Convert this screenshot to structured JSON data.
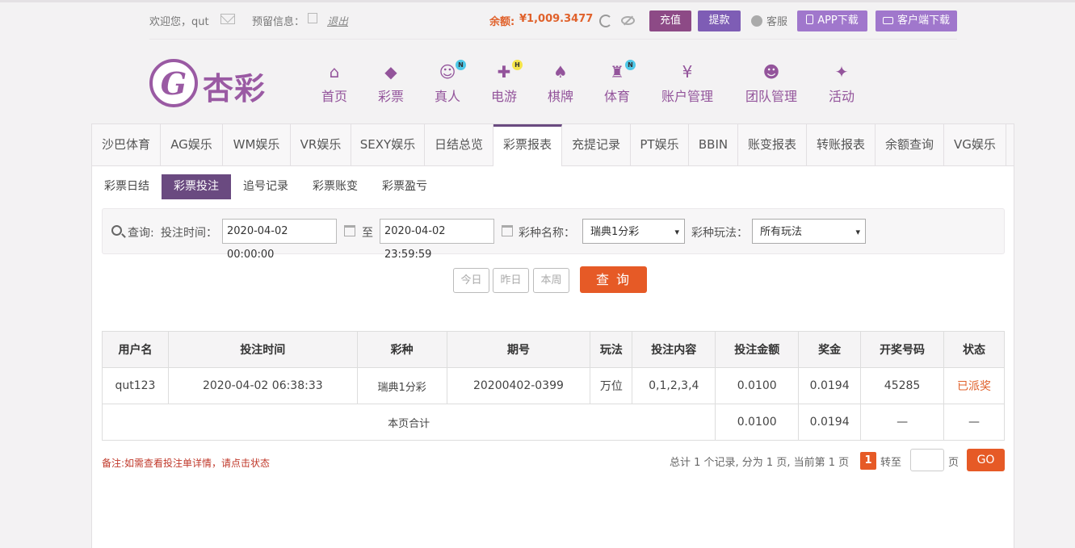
{
  "topbar": {
    "welcome": "欢迎您，qut",
    "message_label": "预留信息：",
    "logout": "退出",
    "balance_label": "余额:",
    "balance_value": "¥1,009.3477",
    "recharge": "充值",
    "withdraw": "提款",
    "service": "客服",
    "app_download": "APP下载",
    "client_download": "客户端下载"
  },
  "logo": {
    "text": "杏彩"
  },
  "nav": [
    {
      "label": "首页",
      "icon": "home-icon"
    },
    {
      "label": "彩票",
      "icon": "lottery-icon"
    },
    {
      "label": "真人",
      "icon": "live-dealer-icon",
      "badge": "N"
    },
    {
      "label": "电游",
      "icon": "gamepad-icon",
      "badge": "H"
    },
    {
      "label": "棋牌",
      "icon": "cards-icon"
    },
    {
      "label": "体育",
      "icon": "trophy-icon",
      "badge": "N"
    },
    {
      "label": "账户管理",
      "icon": "yen-icon"
    },
    {
      "label": "团队管理",
      "icon": "team-icon"
    },
    {
      "label": "活动",
      "icon": "gift-icon"
    }
  ],
  "tabs": [
    "沙巴体育",
    "AG娱乐",
    "WM娱乐",
    "VR娱乐",
    "SEXY娱乐",
    "日结总览",
    "彩票报表",
    "充提记录",
    "PT娱乐",
    "BBIN",
    "账变报表",
    "转账报表",
    "余额查询",
    "VG娱乐"
  ],
  "active_tab": "彩票报表",
  "subtabs": [
    "彩票日结",
    "彩票投注",
    "追号记录",
    "彩票账变",
    "彩票盈亏"
  ],
  "active_subtab": "彩票投注",
  "query": {
    "label": "查询:",
    "time_label": "投注时间：",
    "start": "2020-04-02 00:00:00",
    "to": "至",
    "end": "2020-04-02 23:59:59",
    "lottery_label": "彩种名称：",
    "lottery_value": "瑞典1分彩",
    "play_label": "彩种玩法：",
    "play_value": "所有玩法",
    "today": "今日",
    "yesterday": "昨日",
    "this_week": "本周",
    "submit": "查 询"
  },
  "table": {
    "headers": [
      "用户名",
      "投注时间",
      "彩种",
      "期号",
      "玩法",
      "投注内容",
      "投注金额",
      "奖金",
      "开奖号码",
      "状态"
    ],
    "rows": [
      [
        "qut123",
        "2020-04-02 06:38:33",
        "瑞典1分彩",
        "20200402-0399",
        "万位",
        "0,1,2,3,4",
        "0.0100",
        "0.0194",
        "45285",
        "已派奖"
      ]
    ],
    "total": {
      "label": "本页合计",
      "amount": "0.0100",
      "prize": "0.0194",
      "draw": "—",
      "status": "—"
    }
  },
  "footer": {
    "note": "备注:如需查看投注单详情，请点击状态",
    "pager_text": "总计 1 个记录, 分为 1 页, 当前第 1 页",
    "current_page": "1",
    "goto": "转至",
    "page": "页",
    "go": "GO"
  }
}
